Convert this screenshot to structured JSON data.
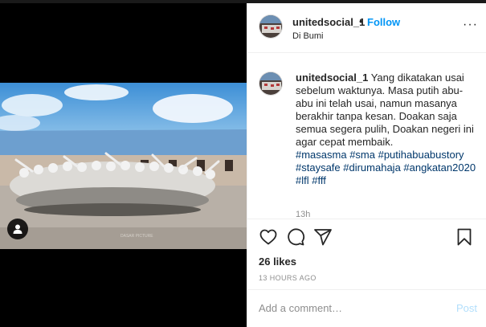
{
  "post": {
    "username": "unitedsocial_1",
    "separator": "•",
    "follow_label": "Follow",
    "location": "Di Bumi",
    "more_icon": "more-options-icon",
    "more_glyph": "···"
  },
  "caption": {
    "username": "unitedsocial_1",
    "text": " Yang dikatakan usai sebelum waktunya. Masa putih abu-abu ini telah usai, namun masanya berakhir tanpa kesan. Doakan saja semua segera pulih, Doakan negeri ini agar cepat membaik.",
    "hashtags": "#masasma #sma #putihabuabustory #staysafe #dirumahaja #angkatan2020 #lfl #fff",
    "time_ago": "13h"
  },
  "actions": {
    "icons": [
      "heart-icon",
      "comment-icon",
      "share-icon",
      "bookmark-icon"
    ],
    "likes": "26 likes",
    "date": "13 HOURS AGO"
  },
  "comment_box": {
    "placeholder": "Add a comment…",
    "post_label": "Post"
  },
  "colors": {
    "link_blue": "#0095f6",
    "hashtag": "#00376b",
    "post_disabled": "#b2dffc",
    "muted": "#8e8e8e"
  }
}
